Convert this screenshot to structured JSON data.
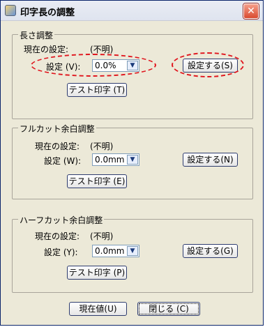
{
  "window": {
    "title": "印字長の調整",
    "close_label": "✕"
  },
  "sections": [
    {
      "title": "長さ調整",
      "current_label": "現在の設定:",
      "current_value": "(不明)",
      "setting_label": "設定 (V):",
      "select_value": "0.0%",
      "set_button": "設定する(S)",
      "test_button": "テスト印字 (T)"
    },
    {
      "title": "フルカット余白調整",
      "current_label": "現在の設定:",
      "current_value": "(不明)",
      "setting_label": "設定 (W):",
      "select_value": "0.0mm",
      "set_button": "設定する(N)",
      "test_button": "テスト印字 (E)"
    },
    {
      "title": "ハーフカット余白調整",
      "current_label": "現在の設定:",
      "current_value": "(不明)",
      "setting_label": "設定 (Y):",
      "select_value": "0.0mm",
      "set_button": "設定する(G)",
      "test_button": "テスト印字 (P)"
    }
  ],
  "footer": {
    "current_button": "現在値(U)",
    "close_button": "閉じる (C)"
  },
  "icons": {
    "dropdown": "chevron-down-icon",
    "close": "close-icon",
    "app": "printer-icon"
  },
  "colors": {
    "annotation": "#e0151d"
  }
}
